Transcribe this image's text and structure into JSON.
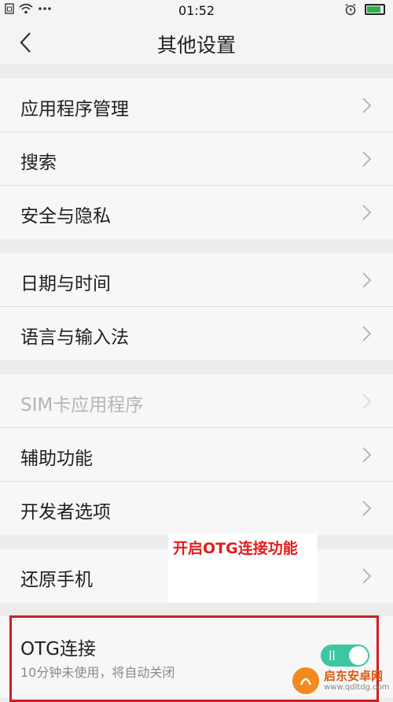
{
  "status_bar": {
    "time": "01:52",
    "left_icons": [
      "sim-icon",
      "wifi-icon",
      "more-dots-icon"
    ],
    "right_icons": [
      "alarm-icon",
      "battery-charging-icon"
    ],
    "battery_level": 0.85,
    "colors": {
      "battery": "#2fb14a"
    }
  },
  "nav": {
    "title": "其他设置",
    "back_icon": "back-chevron-icon"
  },
  "sections": [
    {
      "items": [
        "应用程序管理",
        "搜索",
        "安全与隐私"
      ]
    },
    {
      "items": [
        "日期与时间",
        "语言与输入法"
      ]
    },
    {
      "items": [
        "SIM卡应用程序",
        "辅助功能",
        "开发者选项"
      ],
      "disabled": [
        "SIM卡应用程序"
      ]
    },
    {
      "items": [
        "还原手机"
      ]
    }
  ],
  "annotation": {
    "text": "开启OTG连接功能",
    "color": "#e31d1d"
  },
  "otg": {
    "title": "OTG连接",
    "subtitle": "10分钟未使用，将自动关闭",
    "toggle_on": true,
    "toggle_color": "#3ec6a2",
    "highlight_color": "#cc1f1f"
  },
  "watermark": {
    "name": "启东安卓网",
    "url": "www.qdltdg.com"
  }
}
